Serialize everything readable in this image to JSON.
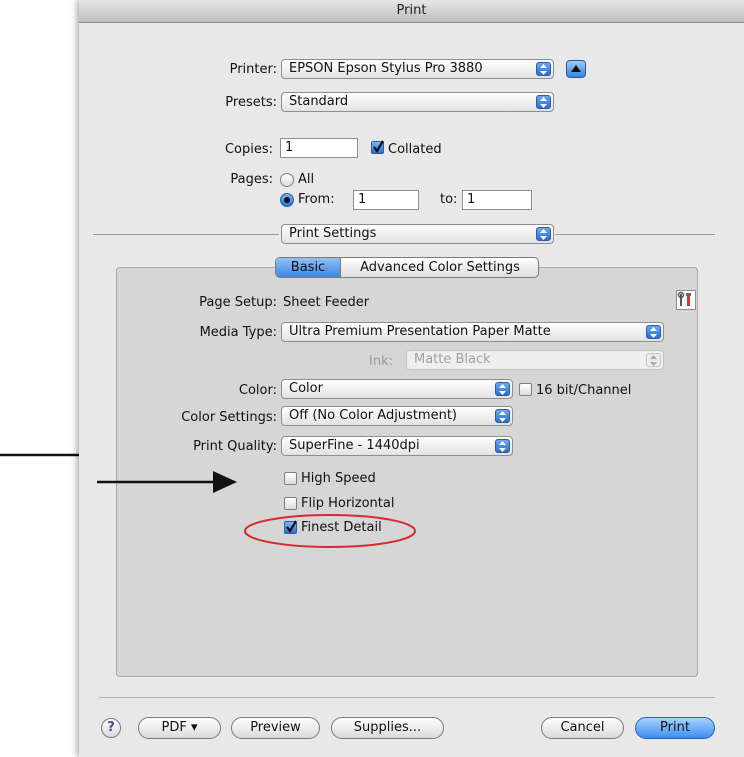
{
  "window": {
    "title": "Print"
  },
  "printer": {
    "label": "Printer:",
    "value": "EPSON Epson Stylus Pro 3880"
  },
  "presets": {
    "label": "Presets:",
    "value": "Standard"
  },
  "copies": {
    "label": "Copies:",
    "value": "1",
    "collated_label": "Collated",
    "collated_checked": true
  },
  "pages": {
    "label": "Pages:",
    "all_label": "All",
    "from_label": "From:",
    "from_value": "1",
    "to_label": "to:",
    "to_value": "1",
    "selected": "From"
  },
  "section_popup": {
    "value": "Print Settings"
  },
  "tabs": [
    {
      "label": "Basic",
      "selected": true
    },
    {
      "label": "Advanced Color Settings",
      "selected": false
    }
  ],
  "settings": {
    "page_setup": {
      "label": "Page Setup:",
      "value": "Sheet Feeder"
    },
    "media_type": {
      "label": "Media Type:",
      "value": "Ultra Premium Presentation Paper Matte"
    },
    "ink": {
      "label": "Ink:",
      "value": "Matte Black",
      "disabled": true
    },
    "color": {
      "label": "Color:",
      "value": "Color",
      "bit_label": "16 bit/Channel",
      "bit_checked": false
    },
    "color_settings": {
      "label": "Color Settings:",
      "value": "Off (No Color Adjustment)"
    },
    "print_quality": {
      "label": "Print Quality:",
      "value": "SuperFine - 1440dpi"
    },
    "checkboxes": [
      {
        "label": "High Speed",
        "checked": false
      },
      {
        "label": "Flip Horizontal",
        "checked": false
      },
      {
        "label": "Finest Detail",
        "checked": true
      }
    ]
  },
  "footer": {
    "help": "?",
    "pdf": "PDF ▾",
    "preview": "Preview",
    "supplies": "Supplies...",
    "cancel": "Cancel",
    "print": "Print"
  },
  "icons": {
    "utility": "printer-utility-icon",
    "disclosure": "disclosure-up-icon"
  },
  "colors": {
    "accent": "#2a6ed1",
    "annotation_circle": "#d42b2b",
    "arrow": "#111111"
  }
}
